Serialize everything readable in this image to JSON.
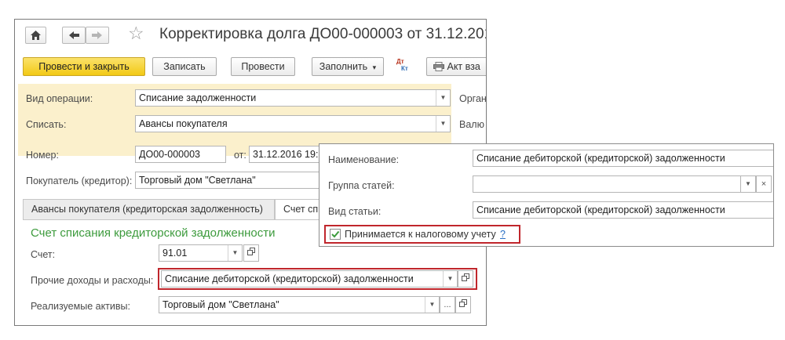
{
  "window": {
    "title": "Корректировка долга ДО00-000003 от 31.12.201",
    "favorite_glyph": "☆"
  },
  "toolbar": {
    "post_close": "Провести и закрыть",
    "save": "Записать",
    "post": "Провести",
    "fill": "Заполнить",
    "fill_arrow": "▾",
    "dtkt_top": "Дт",
    "dtkt_bottom": "Кт",
    "act": "Акт вза"
  },
  "form": {
    "operation_label": "Вид операции:",
    "operation_value": "Списание задолженности",
    "writeoff_label": "Списать:",
    "writeoff_value": "Авансы покупателя",
    "org_label": "Орган",
    "currency_label": "Валю",
    "number_label": "Номер:",
    "number_value": "ДО00-000003",
    "date_label": "от:",
    "date_value": "31.12.2016 19:",
    "buyer_label": "Покупатель (кредитор):",
    "buyer_value": "Торговый дом \"Светлана\""
  },
  "tabs": [
    {
      "label": "Авансы покупателя (кредиторская задолженность)"
    },
    {
      "label": "Счет спи"
    }
  ],
  "section": {
    "title": "Счет списания кредиторской задолженности",
    "account_label": "Счет:",
    "account_value": "91.01",
    "other_label": "Прочие доходы и расходы:",
    "other_value": "Списание дебиторской (кредиторской) задолженности",
    "assets_label": "Реализуемые активы:",
    "assets_value": "Торговый дом \"Светлана\"",
    "ellipsis": "..."
  },
  "popup": {
    "name_label": "Наименование:",
    "name_value": "Списание дебиторской (кредиторской) задолженности",
    "group_label": "Группа статей:",
    "group_value": "",
    "clear_glyph": "×",
    "type_label": "Вид статьи:",
    "type_value": "Списание дебиторской (кредиторской) задолженности",
    "tax_label": "Принимается к налоговому учету",
    "tax_help": "?",
    "tax_checked": true
  },
  "colors": {
    "primary_button": "#f2c915",
    "highlight_band": "#fbf0cc",
    "section_title": "#3d9b3d",
    "red_outline": "#c0262c",
    "checkmark": "#3b9a3b"
  }
}
